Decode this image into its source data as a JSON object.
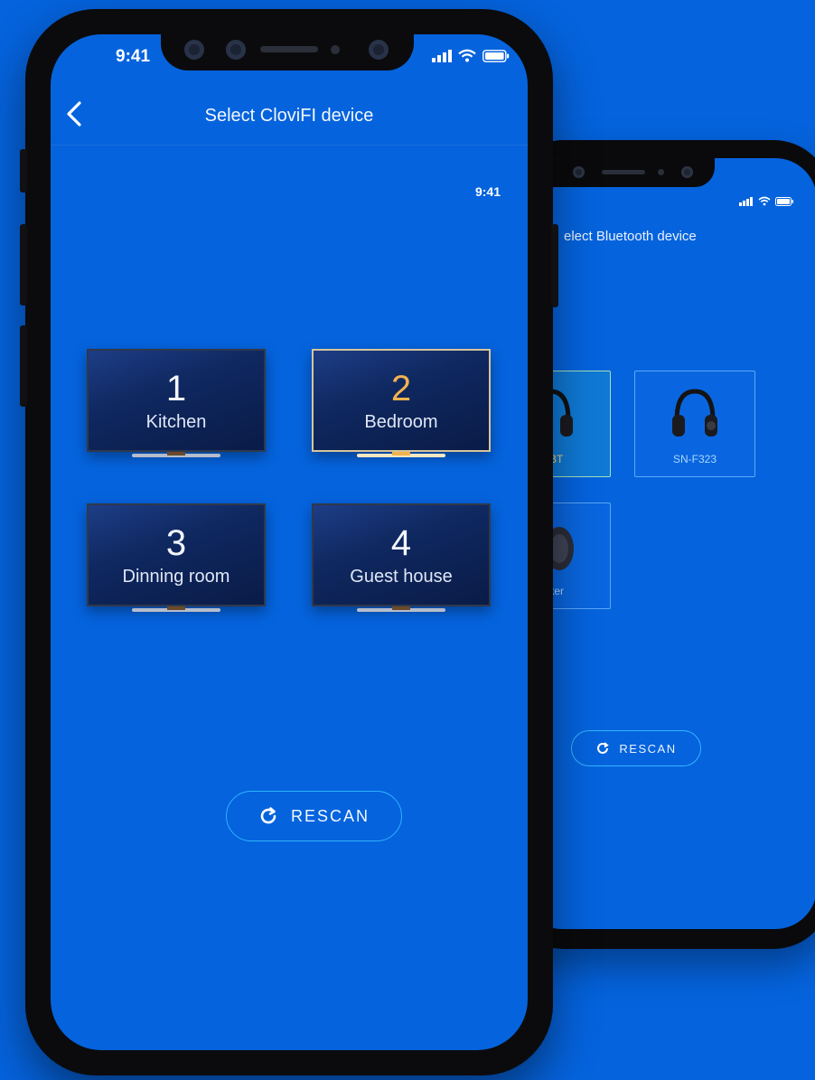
{
  "back_phone": {
    "title": "elect Bluetooth device",
    "devices": [
      {
        "label": "40BT",
        "selected": true
      },
      {
        "label": "SN-F323",
        "selected": false
      },
      {
        "label": "eaker",
        "selected": false
      }
    ],
    "rescan_label": "RESCAN"
  },
  "front_phone": {
    "status": {
      "time": "9:41",
      "inner_time": "9:41"
    },
    "title": "Select CloviFI device",
    "rooms": [
      {
        "number": "1",
        "name": "Kitchen",
        "selected": false
      },
      {
        "number": "2",
        "name": "Bedroom",
        "selected": true
      },
      {
        "number": "3",
        "name": "Dinning room",
        "selected": false
      },
      {
        "number": "4",
        "name": "Guest house",
        "selected": false
      }
    ],
    "rescan_label": "RESCAN"
  },
  "colors": {
    "background": "#0563dd",
    "accent_selected": "#f3b24e",
    "outline": "#2fb2ff",
    "bezel": "#0b0b0d"
  },
  "icons": [
    "back-arrow-icon",
    "signal-icon",
    "wifi-icon",
    "battery-icon",
    "refresh-icon",
    "headphones-icon",
    "speaker-icon"
  ]
}
